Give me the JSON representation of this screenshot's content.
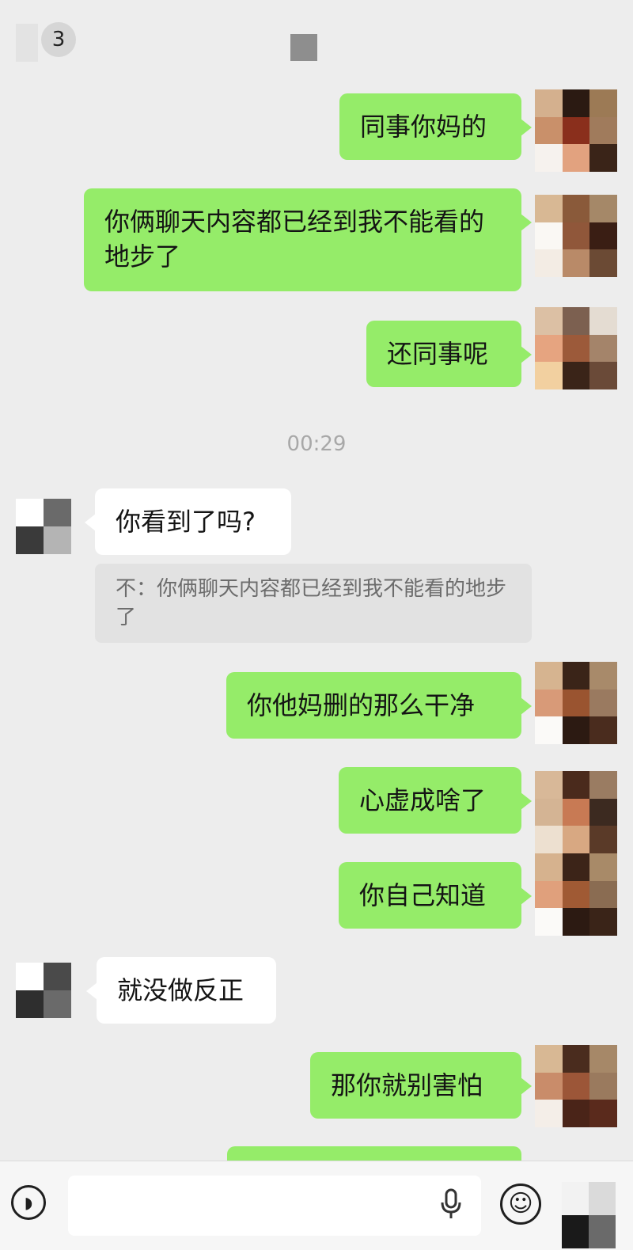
{
  "header": {
    "back_badge": "3"
  },
  "messages": [
    {
      "text": "同事你妈的"
    },
    {
      "text": "你俩聊天内容都已经到我不能看的地步了"
    },
    {
      "text": "还同事呢"
    },
    {
      "text": "你看到了吗?"
    },
    {
      "text": "你他妈删的那么干净"
    },
    {
      "text": "心虚成啥了"
    },
    {
      "text": "你自己知道"
    },
    {
      "text": "就没做反正"
    },
    {
      "text": "那你就别害怕"
    }
  ],
  "timestamp": "00:29",
  "quote": {
    "text": "不：你俩聊天内容都已经到我不能看的地步了"
  },
  "input": {
    "value": ""
  },
  "icons": {
    "voice": "voice-icon",
    "mic": "microphone-icon",
    "emoji": "emoji-icon"
  },
  "colors": {
    "my_bubble": "#95ec69",
    "other_bubble": "#ffffff",
    "background": "#ededed"
  }
}
